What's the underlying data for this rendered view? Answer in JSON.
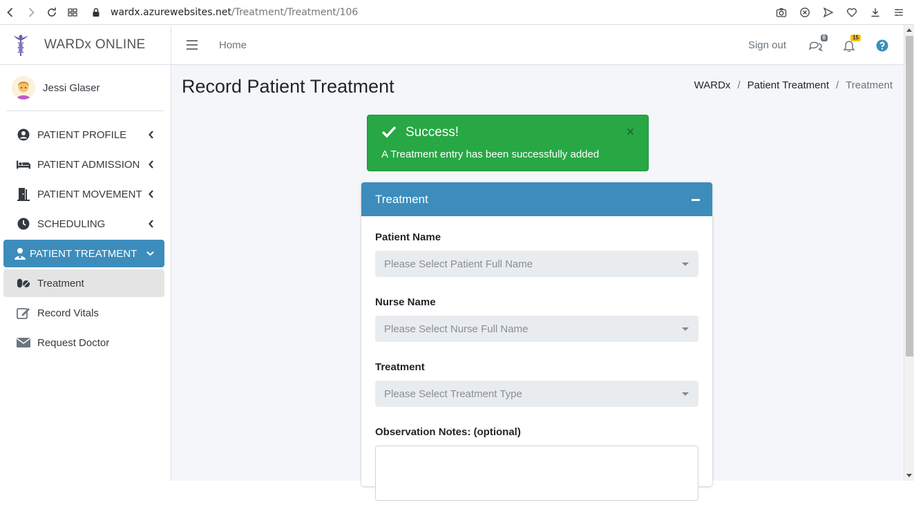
{
  "browser": {
    "url_host": "wardx.azurewebsites.net",
    "url_path": "/Treatment/Treatment/106"
  },
  "brand": {
    "name": "WARDx ONLINE"
  },
  "user": {
    "name": "Jessi Glaser"
  },
  "sidebar": {
    "items": [
      {
        "label": "PATIENT PROFILE",
        "icon": "user-circle-icon"
      },
      {
        "label": "PATIENT ADMISSION",
        "icon": "bed-icon"
      },
      {
        "label": "PATIENT MOVEMENT",
        "icon": "door-exit-icon"
      },
      {
        "label": "SCHEDULING",
        "icon": "clock-icon"
      },
      {
        "label": "PATIENT TREATMENT",
        "icon": "user-nurse-icon"
      },
      {
        "label": "Treatment",
        "icon": "pills-icon"
      },
      {
        "label": "Record Vitals",
        "icon": "edit-icon"
      },
      {
        "label": "Request Doctor",
        "icon": "envelope-icon"
      }
    ]
  },
  "topbar": {
    "home": "Home",
    "signout": "Sign out",
    "messages_count": "0",
    "notifications_count": "15"
  },
  "page": {
    "title": "Record Patient Treatment",
    "breadcrumb": [
      "WARDx",
      "Patient Treatment",
      "Treatment"
    ]
  },
  "alert": {
    "title": "Success!",
    "message": "A Treatment entry has been successfully added",
    "close": "×"
  },
  "form": {
    "header": "Treatment",
    "patient_label": "Patient Name",
    "patient_placeholder": "Please Select Patient Full Name",
    "nurse_label": "Nurse Name",
    "nurse_placeholder": "Please Select Nurse Full Name",
    "treatment_label": "Treatment",
    "treatment_placeholder": "Please Select Treatment Type",
    "notes_label": "Observation Notes: (optional)"
  },
  "colors": {
    "primary": "#3c8dbc",
    "success": "#28a745",
    "content_bg": "#f4f6f9"
  }
}
